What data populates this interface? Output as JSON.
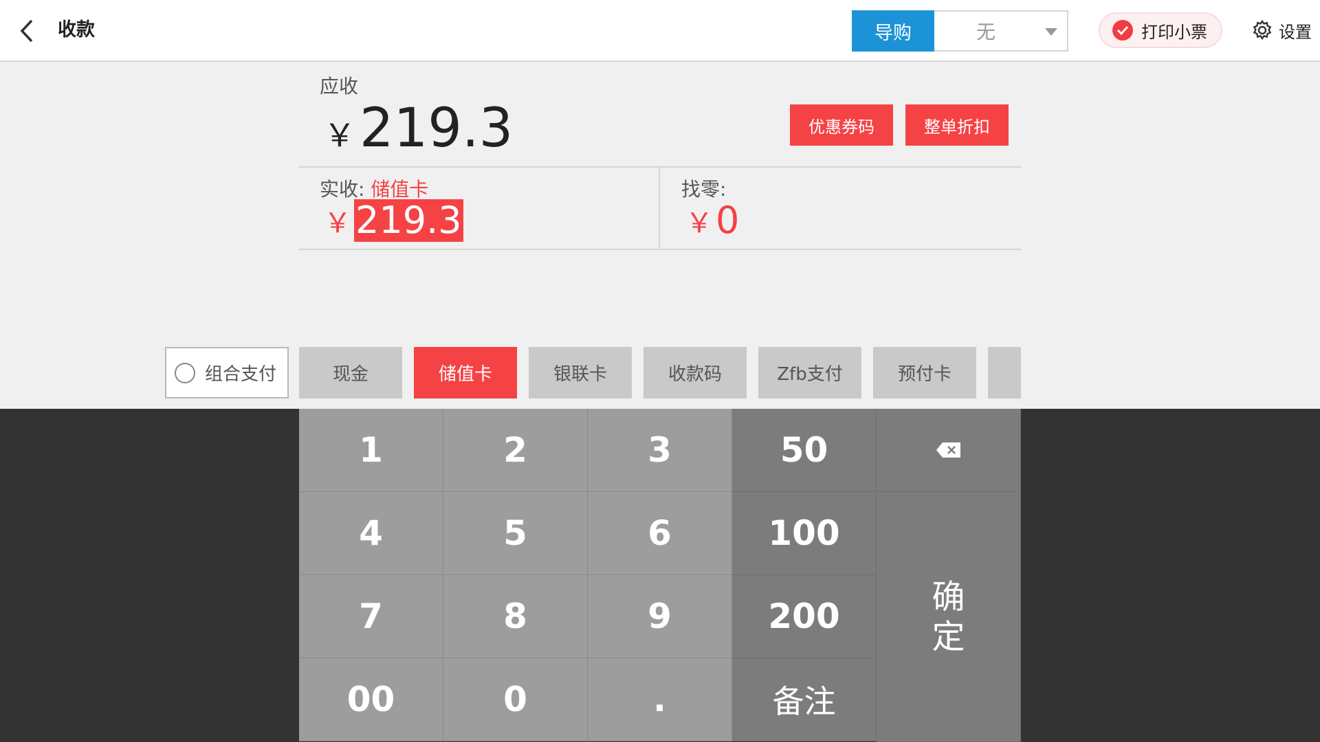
{
  "header": {
    "title": "收款",
    "guide_label": "导购",
    "guide_value": "无",
    "print_label": "打印小票",
    "print_checked": true,
    "settings_label": "设置"
  },
  "amount": {
    "due_label": "应收",
    "currency": "￥",
    "due_value": "219.3",
    "coupon_btn": "优惠券码",
    "discount_btn": "整单折扣",
    "paid_label": "实收:",
    "paid_method": "储值卡",
    "paid_value": "219.3",
    "change_label": "找零:",
    "change_value": "0"
  },
  "payment": {
    "combo_label": "组合支付",
    "tabs": [
      "现金",
      "储值卡",
      "银联卡",
      "收款码",
      "Zfb支付",
      "预付卡"
    ],
    "active_tab": "储值卡"
  },
  "keypad": {
    "k1": "1",
    "k2": "2",
    "k3": "3",
    "k50": "50",
    "k4": "4",
    "k5": "5",
    "k6": "6",
    "k100": "100",
    "k7": "7",
    "k8": "8",
    "k9": "9",
    "k200": "200",
    "k00": "00",
    "k0": "0",
    "kdot": ".",
    "note": "备注",
    "confirm_1": "确",
    "confirm_2": "定"
  },
  "colors": {
    "accent_red": "#f54245",
    "accent_blue": "#1c93d6",
    "keypad_bg": "#333333"
  }
}
